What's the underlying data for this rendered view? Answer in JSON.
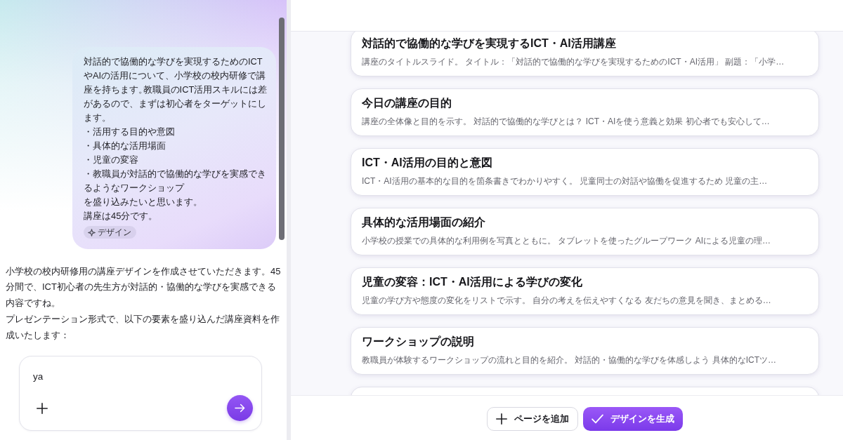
{
  "chat": {
    "messages": [
      {
        "kind": "user",
        "paragraphs": [
          "対話的で協働的な学びを実現するためのICTやAIの活用について、小学校の校内研修で講座を持ちます。教職員のICT活用スキルには差があるので、まずは初心者をターゲットにします。",
          "・活用する目的や意図",
          "・具体的な活用場面",
          "・児童の変容",
          "・教職員が対話的で協働的な学びを実感できるようなワークショップ",
          "を盛り込みたいと思います。",
          "講座は45分です。"
        ],
        "tag": {
          "label": "デザイン"
        }
      },
      {
        "kind": "assistant",
        "paragraphs": [
          "小学校の校内研修用の講座デザインを作成させていただきます。45分間で、ICT初心者の先生方が対話的・協働的な学びを実感できる内容ですね。",
          "プレゼンテーション形式で、以下の要素を盛り込んだ講座資料を作成いたします："
        ]
      }
    ],
    "composer": {
      "value": "ya"
    }
  },
  "outline": {
    "cards": [
      {
        "title": "対話的で協働的な学びを実現するICT・AI活用講座",
        "description": "講座のタイトルスライド。 タイトル：「対話的で協働的な学びを実現するためのICT・AI活用」 副題：「小学…"
      },
      {
        "title": "今日の講座の目的",
        "description": "講座の全体像と目的を示す。 対話的で協働的な学びとは？ ICT・AIを使う意義と効果 初心者でも安心して…"
      },
      {
        "title": "ICT・AI活用の目的と意図",
        "description": "ICT・AI活用の基本的な目的を箇条書きでわかりやすく。 児童同士の対話や協働を促進するため 児童の主…"
      },
      {
        "title": "具体的な活用場面の紹介",
        "description": "小学校の授業での具体的な利用例を写真とともに。 タブレットを使ったグループワーク AIによる児童の理…"
      },
      {
        "title": "児童の変容：ICT・AI活用による学びの変化",
        "description": "児童の学び方や態度の変化をリストで示す。 自分の考えを伝えやすくなる 友だちの意見を聞き、まとめる…"
      },
      {
        "title": "ワークショップの説明",
        "description": "教職員が体験するワークショップの流れと目的を紹介。 対話的・協働的な学びを体感しよう 具体的なICTツ…"
      }
    ],
    "more_below": true
  },
  "actions": [
    {
      "kind": "secondary",
      "label": "ページを追加"
    },
    {
      "kind": "primary",
      "label": "デザインを生成"
    }
  ]
}
